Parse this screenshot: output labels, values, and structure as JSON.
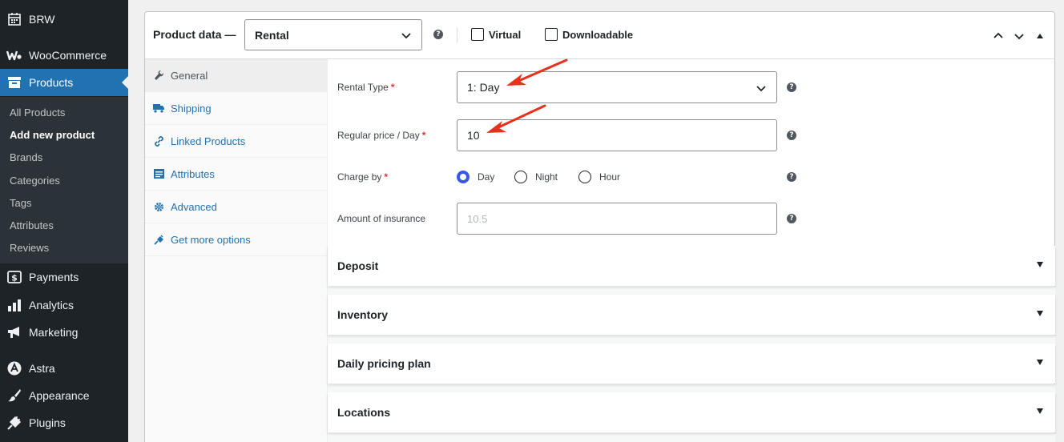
{
  "sidebar": {
    "top_items": [
      {
        "label": "BRW",
        "icon": "calendar-icon"
      },
      {
        "label": "WooCommerce",
        "icon": "woo-icon"
      },
      {
        "label": "Products",
        "icon": "archive-icon"
      }
    ],
    "submenu": [
      "All Products",
      "Add new product",
      "Brands",
      "Categories",
      "Tags",
      "Attributes",
      "Reviews"
    ],
    "bottom_items": [
      {
        "label": "Payments",
        "icon": "dollar-icon"
      },
      {
        "label": "Analytics",
        "icon": "bar-chart-icon"
      },
      {
        "label": "Marketing",
        "icon": "megaphone-icon"
      },
      {
        "label": "Astra",
        "icon": "astra-icon"
      },
      {
        "label": "Appearance",
        "icon": "brush-icon"
      },
      {
        "label": "Plugins",
        "icon": "plug-icon"
      }
    ]
  },
  "product_data": {
    "title": "Product data —",
    "type_value": "Rental",
    "virtual_label": "Virtual",
    "downloadable_label": "Downloadable"
  },
  "tabs": [
    {
      "label": "General",
      "icon": "wrench-icon"
    },
    {
      "label": "Shipping",
      "icon": "truck-icon"
    },
    {
      "label": "Linked Products",
      "icon": "link-icon"
    },
    {
      "label": "Attributes",
      "icon": "list-icon"
    },
    {
      "label": "Advanced",
      "icon": "gear-icon"
    },
    {
      "label": "Get more options",
      "icon": "plugin-icon"
    }
  ],
  "fields": {
    "rental_type": {
      "label": "Rental Type",
      "value": "1: Day"
    },
    "regular_price": {
      "label": "Regular price / Day",
      "value": "10"
    },
    "charge_by": {
      "label": "Charge by",
      "options": [
        "Day",
        "Night",
        "Hour"
      ],
      "selected": "Day"
    },
    "insurance": {
      "label": "Amount of insurance",
      "placeholder": "10.5"
    },
    "required_mark": "*",
    "help_glyph": "?"
  },
  "sections": [
    "Deposit",
    "Inventory",
    "Daily pricing plan",
    "Locations"
  ],
  "colors": {
    "accent": "#2271b1",
    "arrow": "#e8301c",
    "radio": "#3858e9",
    "required": "#d63638"
  }
}
